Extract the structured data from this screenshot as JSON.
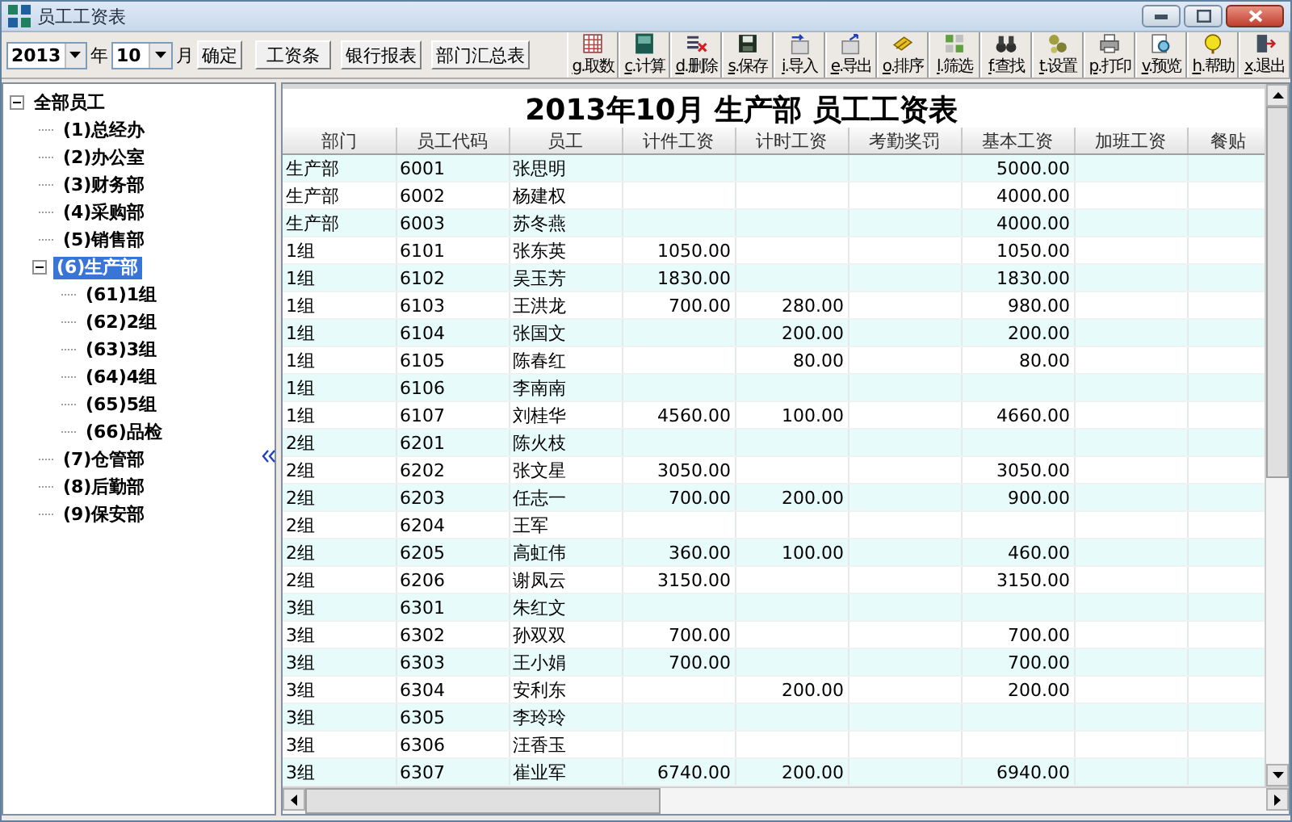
{
  "window": {
    "title": "员工工资表"
  },
  "period": {
    "year": "2013",
    "year_label": "年",
    "month": "10",
    "month_label": "月",
    "confirm": "确定"
  },
  "report_buttons": [
    "工资条",
    "银行报表",
    "部门汇总表"
  ],
  "toolbar": [
    {
      "key": "g",
      "label": ".取数"
    },
    {
      "key": "c",
      "label": ".计算"
    },
    {
      "key": "d",
      "label": ".删除"
    },
    {
      "key": "s",
      "label": ".保存"
    },
    {
      "key": "i",
      "label": ".导入"
    },
    {
      "key": "e",
      "label": ".导出"
    },
    {
      "key": "o",
      "label": ".排序"
    },
    {
      "key": "l",
      "label": ".筛选"
    },
    {
      "key": "f",
      "label": ".查找"
    },
    {
      "key": "t",
      "label": ".设置"
    },
    {
      "key": "p",
      "label": ".打印"
    },
    {
      "key": "v",
      "label": ".预览"
    },
    {
      "key": "h",
      "label": ".帮助"
    },
    {
      "key": "x",
      "label": ".退出"
    }
  ],
  "tree": [
    {
      "label": "全部员工",
      "selected": false,
      "expanded": true,
      "children": [
        {
          "label": "(1)总经办",
          "selected": false
        },
        {
          "label": "(2)办公室",
          "selected": false
        },
        {
          "label": "(3)财务部",
          "selected": false
        },
        {
          "label": "(4)采购部",
          "selected": false
        },
        {
          "label": "(5)销售部",
          "selected": false
        },
        {
          "label": "(6)生产部",
          "selected": true,
          "expanded": true,
          "children": [
            {
              "label": "(61)1组",
              "selected": false
            },
            {
              "label": "(62)2组",
              "selected": false
            },
            {
              "label": "(63)3组",
              "selected": false
            },
            {
              "label": "(64)4组",
              "selected": false
            },
            {
              "label": "(65)5组",
              "selected": false
            },
            {
              "label": "(66)品检",
              "selected": false
            }
          ]
        },
        {
          "label": "(7)仓管部",
          "selected": false
        },
        {
          "label": "(8)后勤部",
          "selected": false
        },
        {
          "label": "(9)保安部",
          "selected": false
        }
      ]
    }
  ],
  "table": {
    "title": "2013年10月 生产部 员工工资表",
    "columns": [
      "部门",
      "员工代码",
      "员工",
      "计件工资",
      "计时工资",
      "考勤奖罚",
      "基本工资",
      "加班工资",
      "餐贴"
    ],
    "rows": [
      [
        "生产部",
        "6001",
        "张思明",
        null,
        null,
        null,
        "5000.00",
        null,
        null
      ],
      [
        "生产部",
        "6002",
        "杨建权",
        null,
        null,
        null,
        "4000.00",
        null,
        null
      ],
      [
        "生产部",
        "6003",
        "苏冬燕",
        null,
        null,
        null,
        "4000.00",
        null,
        null
      ],
      [
        "1组",
        "6101",
        "张东英",
        "1050.00",
        null,
        null,
        "1050.00",
        null,
        null
      ],
      [
        "1组",
        "6102",
        "吴玉芳",
        "1830.00",
        null,
        null,
        "1830.00",
        null,
        null
      ],
      [
        "1组",
        "6103",
        "王洪龙",
        "700.00",
        "280.00",
        null,
        "980.00",
        null,
        null
      ],
      [
        "1组",
        "6104",
        "张国文",
        null,
        "200.00",
        null,
        "200.00",
        null,
        null
      ],
      [
        "1组",
        "6105",
        "陈春红",
        null,
        "80.00",
        null,
        "80.00",
        null,
        null
      ],
      [
        "1组",
        "6106",
        "李南南",
        null,
        null,
        null,
        null,
        null,
        null
      ],
      [
        "1组",
        "6107",
        "刘桂华",
        "4560.00",
        "100.00",
        null,
        "4660.00",
        null,
        null
      ],
      [
        "2组",
        "6201",
        "陈火枝",
        null,
        null,
        null,
        null,
        null,
        null
      ],
      [
        "2组",
        "6202",
        "张文星",
        "3050.00",
        null,
        null,
        "3050.00",
        null,
        null
      ],
      [
        "2组",
        "6203",
        "任志一",
        "700.00",
        "200.00",
        null,
        "900.00",
        null,
        null
      ],
      [
        "2组",
        "6204",
        "王军",
        null,
        null,
        null,
        null,
        null,
        null
      ],
      [
        "2组",
        "6205",
        "高虹伟",
        "360.00",
        "100.00",
        null,
        "460.00",
        null,
        null
      ],
      [
        "2组",
        "6206",
        "谢凤云",
        "3150.00",
        null,
        null,
        "3150.00",
        null,
        null
      ],
      [
        "3组",
        "6301",
        "朱红文",
        null,
        null,
        null,
        null,
        null,
        null
      ],
      [
        "3组",
        "6302",
        "孙双双",
        "700.00",
        null,
        null,
        "700.00",
        null,
        null
      ],
      [
        "3组",
        "6303",
        "王小娟",
        "700.00",
        null,
        null,
        "700.00",
        null,
        null
      ],
      [
        "3组",
        "6304",
        "安利东",
        null,
        "200.00",
        null,
        "200.00",
        null,
        null
      ],
      [
        "3组",
        "6305",
        "李玲玲",
        null,
        null,
        null,
        null,
        null,
        null
      ],
      [
        "3组",
        "6306",
        "汪香玉",
        null,
        null,
        null,
        null,
        null,
        null
      ],
      [
        "3组",
        "6307",
        "崔业军",
        "6740.00",
        "200.00",
        null,
        "6940.00",
        null,
        null
      ]
    ]
  }
}
